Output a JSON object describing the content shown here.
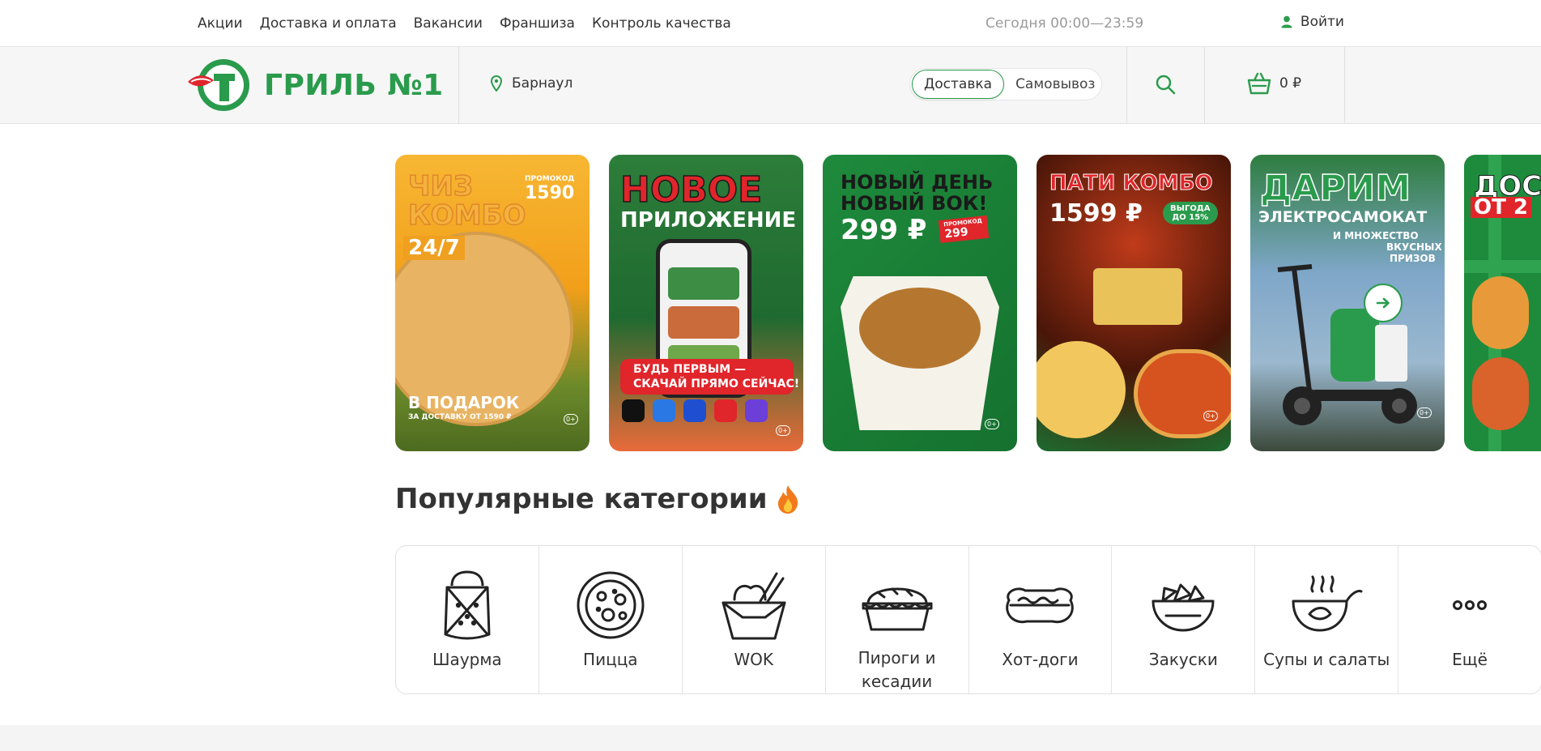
{
  "topbar": {
    "nav": [
      "Акции",
      "Доставка и оплата",
      "Вакансии",
      "Франшиза",
      "Контроль качества"
    ],
    "hours": "Сегодня 00:00—23:59",
    "login_label": "Войти"
  },
  "header": {
    "logo_text": "ГРИЛЬ №1",
    "city": "Барнаул",
    "delivery_options": [
      "Доставка",
      "Самовывоз"
    ],
    "cart_total": "0 ₽"
  },
  "banners": [
    {
      "line1": "ЧИЗ",
      "line2": "КОМБО",
      "line3": "24/7",
      "promo_label": "ПРОМОКОД",
      "promo": "1590",
      "bottom": "В ПОДАРОК",
      "bottom2": "ЗА ДОСТАВКУ ОТ 1590 ₽",
      "age": "0+"
    },
    {
      "line1": "НОВОЕ",
      "line2": "ПРИЛОЖЕНИЕ",
      "bottom": "БУДЬ ПЕРВЫМ —",
      "bottom2": "СКАЧАЙ ПРЯМО СЕЙЧАС!",
      "age": "0+"
    },
    {
      "line1": "НОВЫЙ ДЕНЬ",
      "line2": "НОВЫЙ ВОК!",
      "price": "299 ₽",
      "promo_label": "ПРОМОКОД",
      "promo": "299",
      "age": "0+"
    },
    {
      "line1": "ПАТИ КОМБО",
      "price": "1599 ₽",
      "badge1": "ВЫГОДА",
      "badge2": "ДО 15%",
      "age": "0+"
    },
    {
      "line1": "ДАРИМ",
      "line2": "ЭЛЕКТРОСАМОКАТ",
      "line3": "И МНОЖЕСТВО",
      "line4": "ВКУСНЫХ",
      "line5": "ПРИЗОВ",
      "age": "0+"
    },
    {
      "line1": "ДОС",
      "line2": "ОТ 2"
    }
  ],
  "categories_section": {
    "title": "Популярные категории",
    "items": [
      {
        "label": "Шаурма",
        "icon": "shawarma-icon"
      },
      {
        "label": "Пицца",
        "icon": "pizza-icon"
      },
      {
        "label": "WOK",
        "icon": "wok-icon"
      },
      {
        "label": "Пироги и кесадии",
        "icon": "pie-icon"
      },
      {
        "label": "Хот-доги",
        "icon": "hotdog-icon"
      },
      {
        "label": "Закуски",
        "icon": "snacks-icon"
      },
      {
        "label": "Супы и салаты",
        "icon": "soup-icon"
      },
      {
        "label": "Ещё",
        "icon": "more-icon"
      }
    ]
  },
  "colors": {
    "brand_green": "#2a9b4c",
    "brand_red": "#e0252b"
  }
}
